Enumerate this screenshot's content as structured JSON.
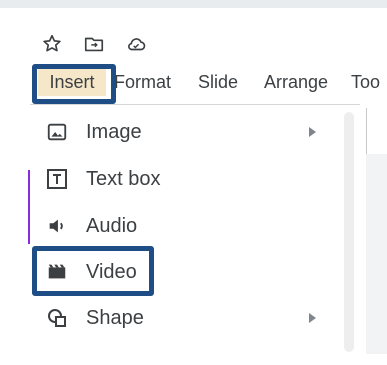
{
  "menubar": {
    "items": [
      {
        "label": "Insert"
      },
      {
        "label": "Format"
      },
      {
        "label": "Slide"
      },
      {
        "label": "Arrange"
      },
      {
        "label": "Too"
      }
    ]
  },
  "toolbar_icons": [
    "star-icon",
    "folder-move-icon",
    "cloud-icon"
  ],
  "insert_menu": {
    "items": [
      {
        "label": "Image",
        "icon": "image-icon",
        "has_submenu": true
      },
      {
        "label": "Text box",
        "icon": "text-box-icon",
        "has_submenu": false
      },
      {
        "label": "Audio",
        "icon": "audio-icon",
        "has_submenu": false
      },
      {
        "label": "Video",
        "icon": "video-icon",
        "has_submenu": false
      },
      {
        "label": "Shape",
        "icon": "shape-icon",
        "has_submenu": true
      }
    ]
  },
  "colors": {
    "highlight_border": "#1f4e86",
    "insert_active_bg": "#f6e7c8",
    "text": "#3c4043"
  }
}
